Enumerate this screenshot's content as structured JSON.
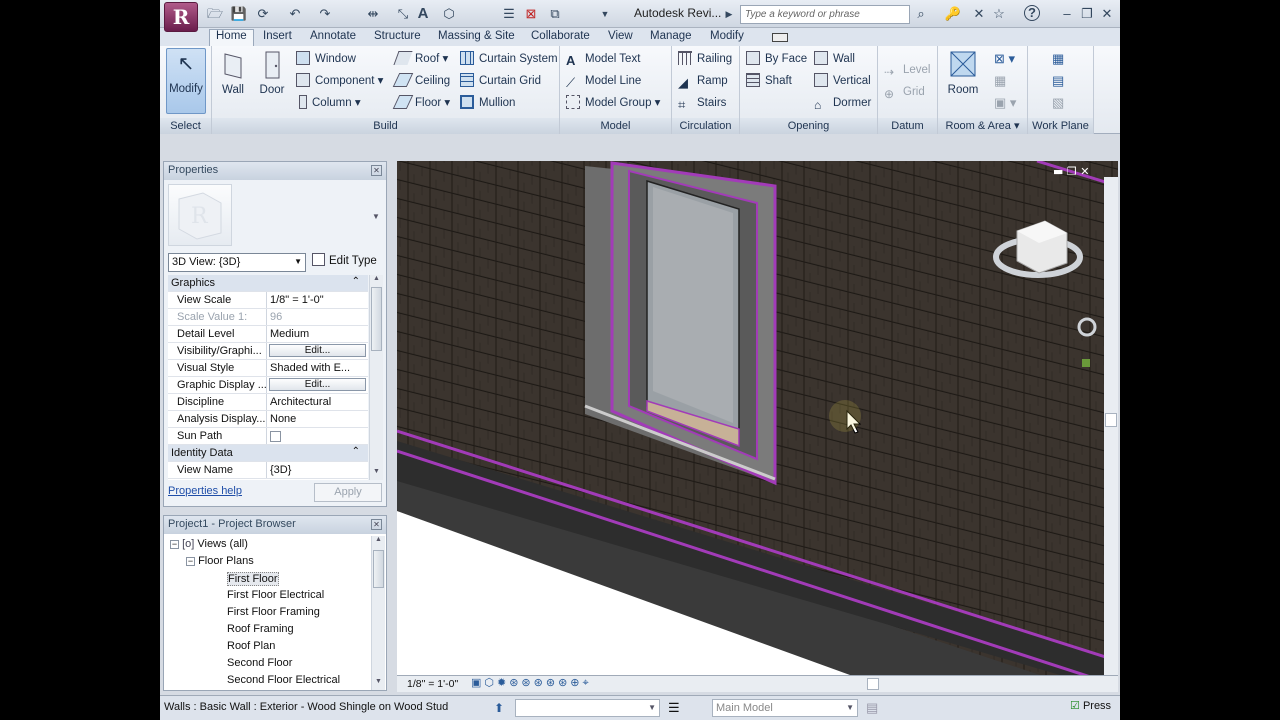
{
  "app": {
    "title": "Autodesk Revi...",
    "search_placeholder": "Type a keyword or phrase",
    "logo_letter": "R"
  },
  "tabs": [
    "Home",
    "Insert",
    "Annotate",
    "Structure",
    "Massing & Site",
    "Collaborate",
    "View",
    "Manage",
    "Modify"
  ],
  "ribbon": {
    "select": {
      "modify": "Modify",
      "label": "Select"
    },
    "build": {
      "wall": "Wall",
      "door": "Door",
      "window": "Window",
      "component": "Component",
      "column": "Column",
      "roof": "Roof",
      "ceiling": "Ceiling",
      "floor": "Floor",
      "curtain_system": "Curtain System",
      "curtain_grid": "Curtain Grid",
      "mullion": "Mullion",
      "label": "Build"
    },
    "model": {
      "model_text": "Model Text",
      "model_line": "Model Line",
      "model_group": "Model Group",
      "label": "Model"
    },
    "circulation": {
      "railing": "Railing",
      "ramp": "Ramp",
      "stairs": "Stairs",
      "label": "Circulation"
    },
    "opening": {
      "by_face": "By Face",
      "shaft": "Shaft",
      "wall": "Wall",
      "vertical": "Vertical",
      "dormer": "Dormer",
      "label": "Opening"
    },
    "datum": {
      "level": "Level",
      "grid": "Grid",
      "label": "Datum"
    },
    "room_area": {
      "room": "Room",
      "label": "Room & Area"
    },
    "work_plane": {
      "label": "Work Plane"
    }
  },
  "properties": {
    "title": "Properties",
    "type_selector": "3D View: {3D}",
    "edit_type": "Edit Type",
    "rows": [
      {
        "section": "Graphics"
      },
      {
        "k": "View Scale",
        "v": "1/8\" = 1'-0\""
      },
      {
        "k": "Scale Value    1:",
        "v": "96",
        "disabled": true
      },
      {
        "k": "Detail Level",
        "v": "Medium"
      },
      {
        "k": "Visibility/Graphi...",
        "v": "Edit...",
        "button": true
      },
      {
        "k": "Visual Style",
        "v": "Shaded with E..."
      },
      {
        "k": "Graphic Display ...",
        "v": "Edit...",
        "button": true
      },
      {
        "k": "Discipline",
        "v": "Architectural"
      },
      {
        "k": "Analysis Display...",
        "v": "None"
      },
      {
        "k": "Sun Path",
        "v": "",
        "checkbox": true
      },
      {
        "section": "Identity Data"
      },
      {
        "k": "View Name",
        "v": "{3D}"
      }
    ],
    "help": "Properties help",
    "apply": "Apply"
  },
  "browser": {
    "title": "Project1 - Project Browser",
    "views_all": "Views (all)",
    "floor_plans": "Floor Plans",
    "items": [
      "First Floor",
      "First Floor Electrical",
      "First Floor Framing",
      "Roof Framing",
      "Roof Plan",
      "Second Floor",
      "Second Floor Electrical"
    ],
    "selected": "First Floor"
  },
  "viewbar": {
    "scale": "1/8\" = 1'-0\""
  },
  "status": {
    "text": "Walls : Basic Wall : Exterior - Wood Shingle on Wood Stud",
    "model": "Main Model",
    "press": "Press"
  },
  "colors": {
    "selection_highlight": "#a23bb8",
    "shingle": "#3a332d",
    "ribbon_text": "#1e3350"
  }
}
